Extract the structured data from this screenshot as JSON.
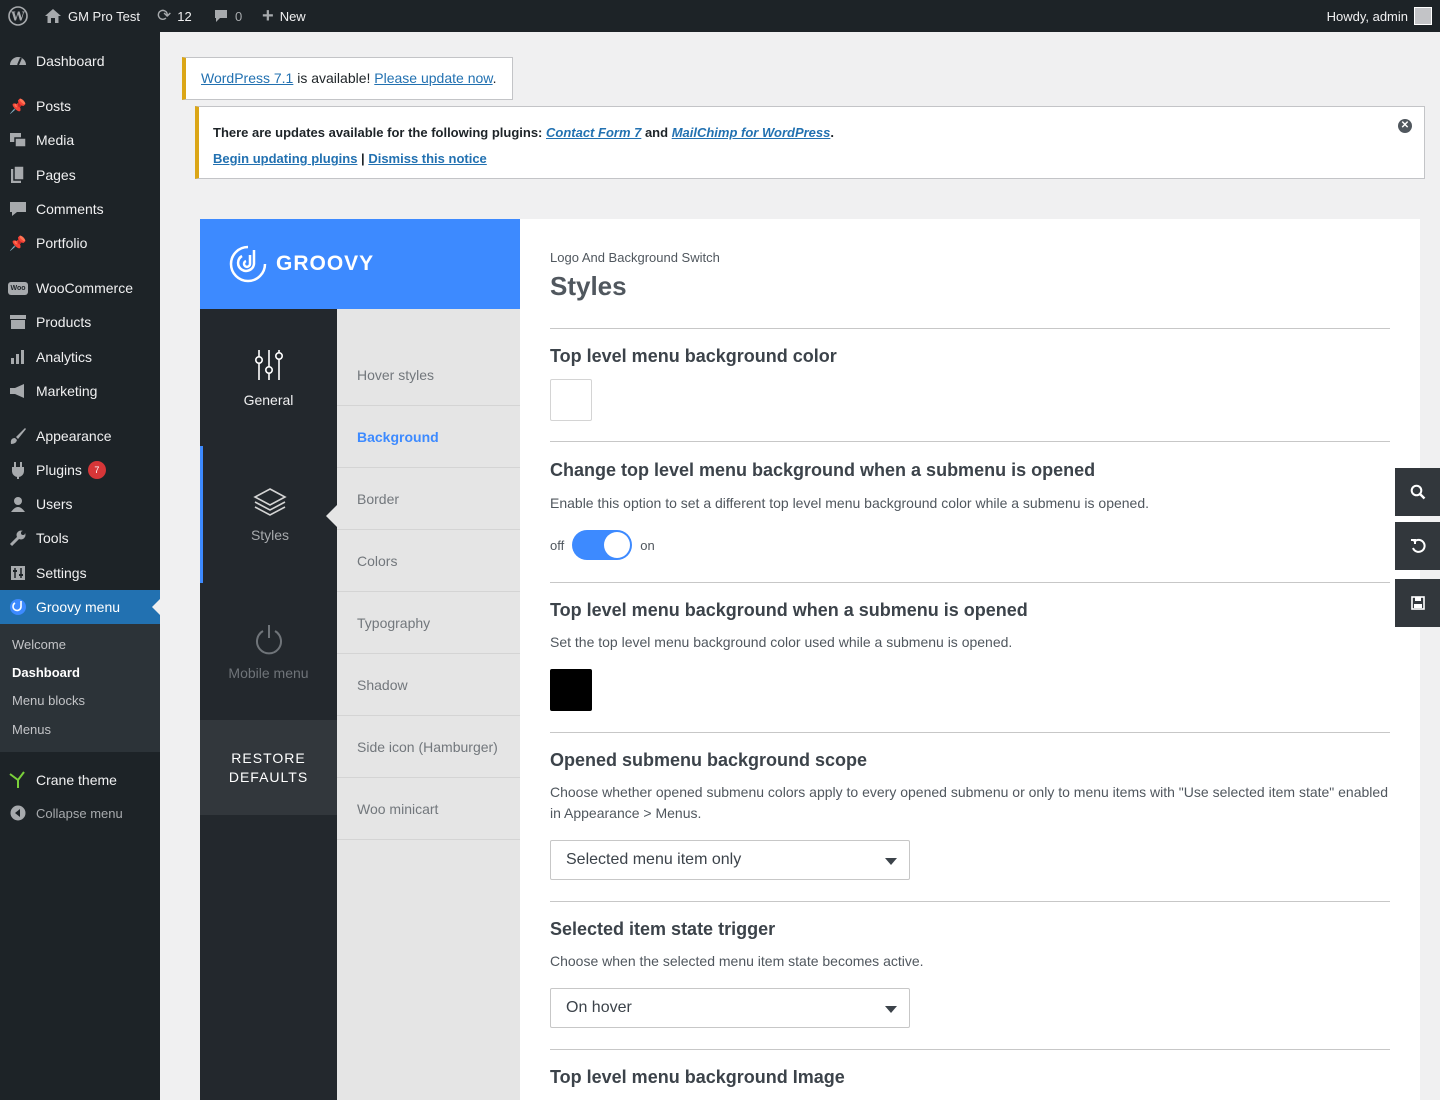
{
  "adminbar": {
    "site_name": "GM Pro Test",
    "updates_count": "12",
    "comments_count": "0",
    "new_label": "New",
    "howdy": "Howdy, admin"
  },
  "sidebar": {
    "items": [
      {
        "label": "Dashboard",
        "icon": "dashboard-icon"
      },
      {
        "label": "Posts",
        "icon": "pin-icon"
      },
      {
        "label": "Media",
        "icon": "media-icon"
      },
      {
        "label": "Pages",
        "icon": "pages-icon"
      },
      {
        "label": "Comments",
        "icon": "comment-icon"
      },
      {
        "label": "Portfolio",
        "icon": "pin-icon"
      },
      {
        "label": "WooCommerce",
        "icon": "woo-icon"
      },
      {
        "label": "Products",
        "icon": "archive-icon"
      },
      {
        "label": "Analytics",
        "icon": "bar-chart-icon"
      },
      {
        "label": "Marketing",
        "icon": "megaphone-icon"
      },
      {
        "label": "Appearance",
        "icon": "brush-icon"
      },
      {
        "label": "Plugins",
        "icon": "plugin-icon",
        "badge": "7"
      },
      {
        "label": "Users",
        "icon": "user-icon"
      },
      {
        "label": "Tools",
        "icon": "wrench-icon"
      },
      {
        "label": "Settings",
        "icon": "settings-icon"
      },
      {
        "label": "Groovy menu",
        "icon": "groovy-icon"
      },
      {
        "label": "Crane theme",
        "icon": "crane-icon"
      },
      {
        "label": "Collapse menu",
        "icon": "collapse-icon"
      }
    ],
    "submenu": [
      "Welcome",
      "Dashboard",
      "Menu blocks",
      "Menus"
    ]
  },
  "notices": {
    "wp_update": {
      "link": "WordPress 7.1",
      "middle": " is available! ",
      "update_link": "Please update now",
      "end": "."
    },
    "plugins": {
      "text": "There are updates available for the following plugins: ",
      "plugin1": "Contact Form 7",
      "and": " and ",
      "plugin2": "MailChimp for WordPress",
      "end": ".",
      "begin": "Begin updating plugins",
      "sep": " | ",
      "dismiss": "Dismiss this notice"
    }
  },
  "groovy": {
    "logo_text": "GROOVY",
    "tabs": [
      "General",
      "Styles",
      "Mobile menu"
    ],
    "restore": [
      "RESTORE",
      "DEFAULTS"
    ],
    "subtabs": [
      "Hover styles",
      "Background",
      "Border",
      "Colors",
      "Typography",
      "Shadow",
      "Side icon (Hamburger)",
      "Woo minicart"
    ],
    "breadcrumb": "Logo And Background Switch",
    "title": "Styles",
    "fields": {
      "f1_title": "Top level menu background color",
      "f2_title": "Change top level menu background when a submenu is opened",
      "f2_desc": "Enable this option to set a different top level menu background color while a submenu is opened.",
      "toggle_off": "off",
      "toggle_on": "on",
      "f3_title": "Top level menu background when a submenu is opened",
      "f3_desc": "Set the top level menu background color used while a submenu is opened.",
      "f4_title": "Opened submenu background scope",
      "f4_desc": "Choose whether opened submenu colors apply to every opened submenu or only to menu items with \"Use selected item state\" enabled in Appearance > Menus.",
      "f4_value": "Selected menu item only",
      "f5_title": "Selected item state trigger",
      "f5_desc": "Choose when the selected menu item state becomes active.",
      "f5_value": "On hover",
      "f6_title": "Top level menu background Image"
    },
    "swatch1_color": "#ffffff",
    "swatch2_color": "#000000",
    "accent": "#3d8aff"
  },
  "tools": [
    "search-icon",
    "undo-icon",
    "save-icon"
  ]
}
